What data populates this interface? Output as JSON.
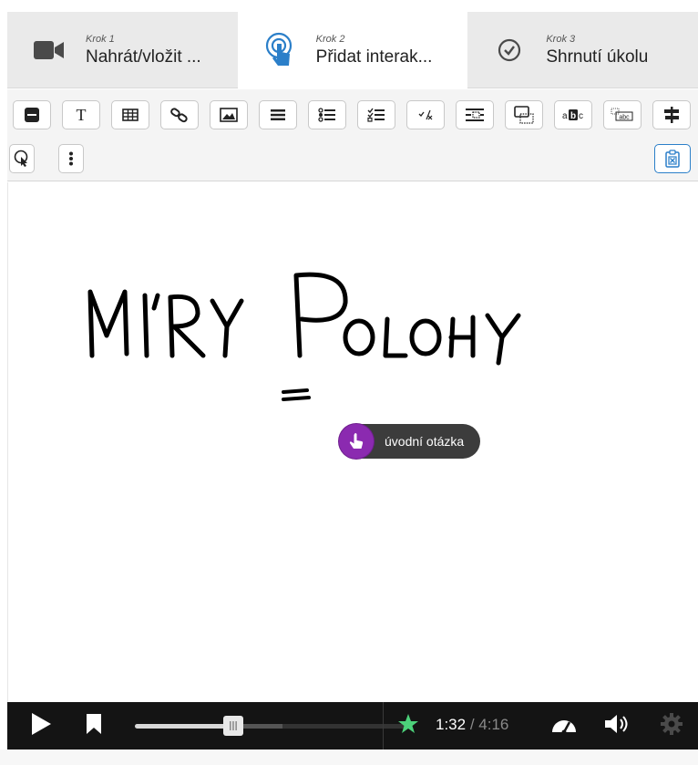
{
  "steps": [
    {
      "small": "Krok 1",
      "big": "Nahrát/vložit ...",
      "icon": "video-camera-icon",
      "active": false
    },
    {
      "small": "Krok 2",
      "big": "Přidat interak...",
      "icon": "touch-pointer-icon",
      "active": true
    },
    {
      "small": "Krok 3",
      "big": "Shrnutí úkolu",
      "icon": "check-circle-icon",
      "active": false
    }
  ],
  "toolbar": {
    "tools": [
      "label-tool",
      "text-tool",
      "table-tool",
      "link-tool",
      "image-tool",
      "statements-tool",
      "single-choice-tool",
      "multiple-choice-tool",
      "true-false-tool",
      "fill-blanks-tool",
      "drag-and-drop-tool",
      "mark-words-tool",
      "drag-text-tool",
      "crossroads-tool",
      "navigation-hotspot-tool",
      "more-tool",
      "paste-tool"
    ]
  },
  "canvas": {
    "handwritten_title": "MI'RY POLOHY",
    "hotspot_label": "úvodní otázka"
  },
  "player": {
    "current_time": "1:32",
    "separator": " / ",
    "total_time": "4:16",
    "progress_fraction": 0.36,
    "icons": [
      "play-icon",
      "bookmark-icon",
      "star-marker-icon",
      "speed-gauge-icon",
      "volume-icon",
      "settings-gear-icon"
    ]
  },
  "colors": {
    "accent_purple": "#8b2ab0",
    "step_icon_blue": "#2b7fc9",
    "player_bg": "#141414",
    "star_green": "#4cd17a"
  }
}
